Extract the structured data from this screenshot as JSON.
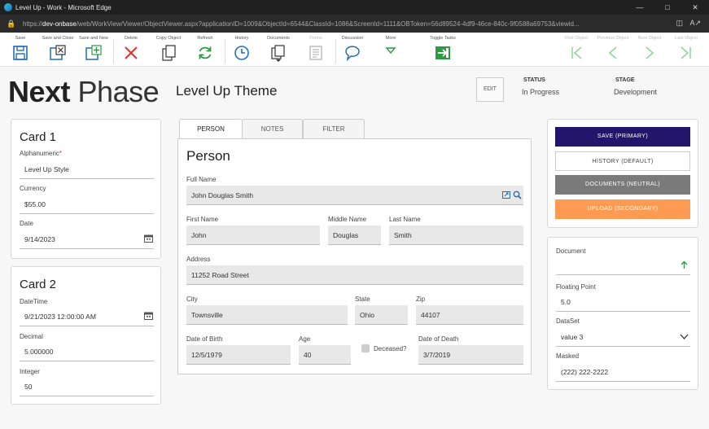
{
  "window": {
    "title": "Level Up - Work - Microsoft Edge",
    "url_prefix": "https://",
    "url_host": "dev-onbase",
    "url_rest": "/web/WorkView/Viewer/ObjectViewer.aspx?applicationID=1009&ObjectId=6544&ClassId=1086&ScreenId=1111&OBToken=56d89524-4df9-46ce-840c-9f0588a69753&viewid..."
  },
  "toolbar": {
    "save": "Save",
    "save_close": "Save and Close",
    "save_new": "Save and New",
    "delete": "Delete",
    "copy_object": "Copy Object",
    "refresh": "Refresh",
    "history": "History",
    "documents": "Documents",
    "forms": "Forms",
    "discussion": "Discussion",
    "more": "More",
    "toggle_tasks": "Toggle Tasks",
    "first_object": "First Object",
    "previous_object": "Previous Object",
    "next_object": "Next Object",
    "last_object": "Last Object"
  },
  "header": {
    "logo_bold": "Next",
    "logo_light": "Phase",
    "theme_title": "Level Up Theme",
    "edit": "EDIT",
    "status_label": "STATUS",
    "status_value": "In Progress",
    "stage_label": "STAGE",
    "stage_value": "Development"
  },
  "card1": {
    "title": "Card 1",
    "alphanumeric_label": "Alphanumeric",
    "alphanumeric_value": "Level Up Style",
    "currency_label": "Currency",
    "currency_value": "$55.00",
    "date_label": "Date",
    "date_value": "9/14/2023"
  },
  "card2": {
    "title": "Card 2",
    "datetime_label": "DateTime",
    "datetime_value": "9/21/2023 12:00:00 AM",
    "decimal_label": "Decimal",
    "decimal_value": "5.000000",
    "integer_label": "Integer",
    "integer_value": "50"
  },
  "tabs": {
    "person": "PERSON",
    "notes": "NOTES",
    "filter": "FILTER"
  },
  "person": {
    "title": "Person",
    "full_name_label": "Full Name",
    "full_name": "John Douglas Smith",
    "first_name_label": "First Name",
    "first_name": "John",
    "middle_name_label": "Middle Name",
    "middle_name": "Douglas",
    "last_name_label": "Last Name",
    "last_name": "Smith",
    "address_label": "Address",
    "address": "11252 Road Street",
    "city_label": "City",
    "city": "Townsville",
    "state_label": "State",
    "state": "Ohio",
    "zip_label": "Zip",
    "zip": "44107",
    "dob_label": "Date of Birth",
    "dob": "12/5/1979",
    "age_label": "Age",
    "age": "40",
    "deceased_label": "Deceased?",
    "dod_label": "Date of Death",
    "dod": "3/7/2019"
  },
  "actions": {
    "save": "SAVE (PRIMARY)",
    "history": "HISTORY (DEFAULT)",
    "documents": "DOCUMENTS (NEUTRAL)",
    "upload": "UPLOAD (SECONDARY)"
  },
  "side": {
    "document_label": "Document",
    "document_value": "",
    "floating_label": "Floating Point",
    "floating_value": "5.0",
    "dataset_label": "DataSet",
    "dataset_value": "value 3",
    "masked_label": "Masked",
    "masked_value": "(222) 222-2222"
  },
  "colors": {
    "primary": "#23156b",
    "neutral": "#7a7a7a",
    "secondary": "#ff9a52",
    "toolbar_blue": "#1f6fb5",
    "toolbar_green": "#2e9a43",
    "toolbar_red": "#e03131"
  }
}
